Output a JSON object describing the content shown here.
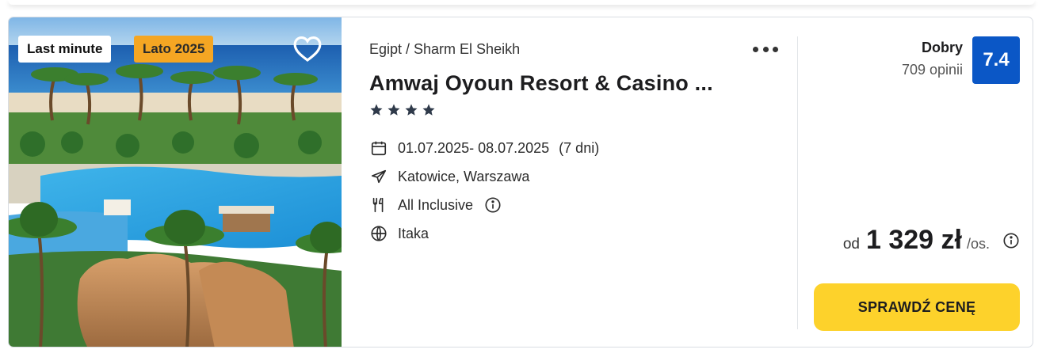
{
  "badges": {
    "tag1": "Last minute",
    "tag2": "Lato 2025"
  },
  "offer": {
    "breadcrumb": "Egipt / Sharm El Sheikh",
    "title": "Amwaj Oyoun Resort & Casino ...",
    "stars": 4,
    "dates": "01.07.2025- 08.07.2025",
    "duration": "(7 dni)",
    "departure": "Katowice, Warszawa",
    "board": "All Inclusive",
    "operator": "Itaka"
  },
  "rating": {
    "label": "Dobry",
    "reviews": "709 opinii",
    "score": "7.4"
  },
  "price": {
    "from": "od",
    "value": "1 329 zł",
    "unit": "/os."
  },
  "cta": {
    "label": "SPRAWDŹ CENĘ"
  },
  "icons": {
    "favorite": "heart-icon",
    "more": "more-dots-icon",
    "dates": "calendar-icon",
    "departure": "plane-icon",
    "board": "fork-knife-icon",
    "operator": "globe-icon",
    "info": "info-icon"
  },
  "colors": {
    "badge_orange": "#f5a623",
    "score_blue": "#0b57c6",
    "cta_yellow": "#fdd22b",
    "star": "#2f3a4a"
  }
}
